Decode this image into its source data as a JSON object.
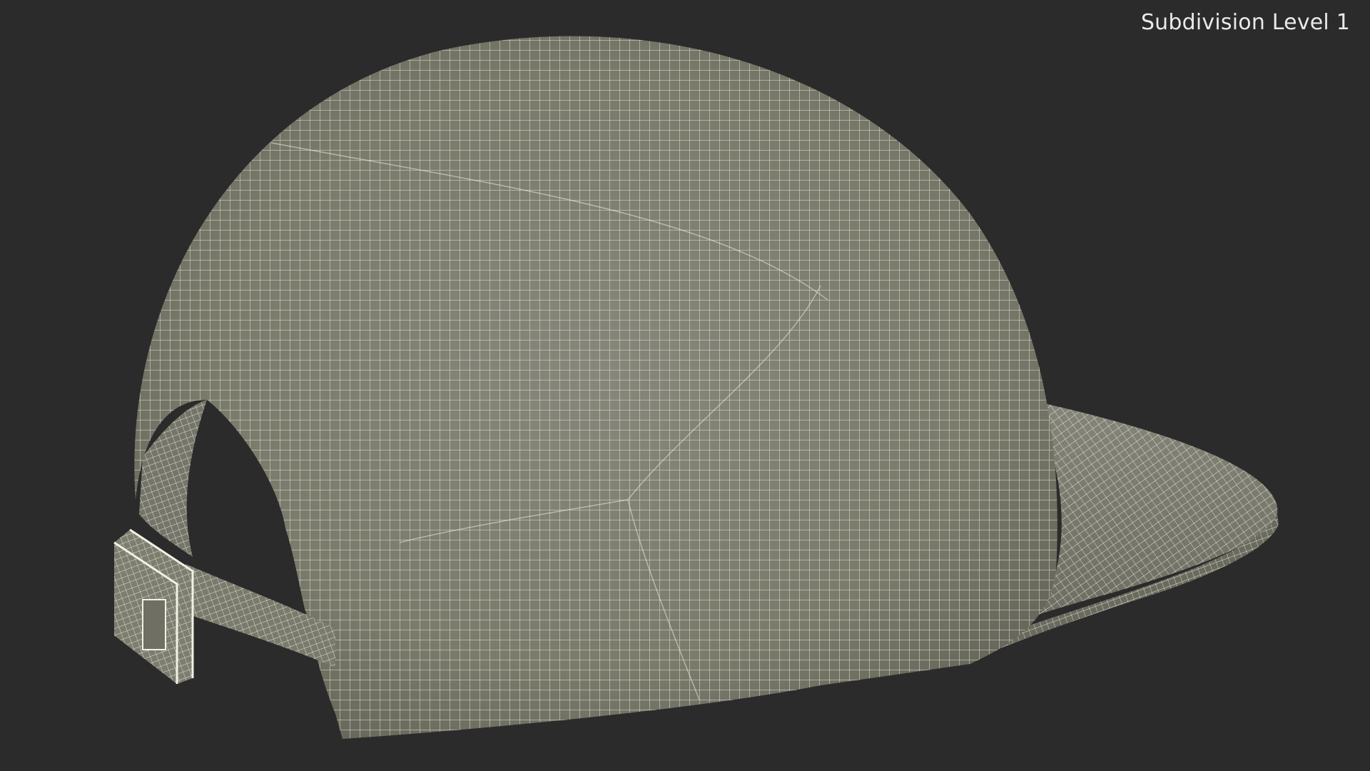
{
  "viewport": {
    "label": "Subdivision Level 1",
    "background_color": "#2b2b2b",
    "label_color": "#e9e9e9"
  },
  "model": {
    "surface_color": "#7b7b6c",
    "wire_color": "#f2f0e4",
    "shadow_color": "#5e5e52",
    "highlight_color": "#8d8d7e"
  }
}
